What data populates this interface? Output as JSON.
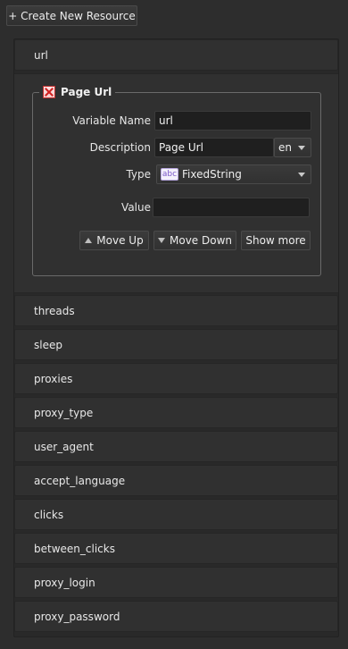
{
  "toolbar": {
    "create_label": "+ Create New Resource"
  },
  "resources": [
    {
      "name": "url"
    },
    {
      "name": "threads"
    },
    {
      "name": "sleep"
    },
    {
      "name": "proxies"
    },
    {
      "name": "proxy_type"
    },
    {
      "name": "user_agent"
    },
    {
      "name": "accept_language"
    },
    {
      "name": "clicks"
    },
    {
      "name": "between_clicks"
    },
    {
      "name": "proxy_login"
    },
    {
      "name": "proxy_password"
    }
  ],
  "editor": {
    "title": "Page Url",
    "close_icon": "red-x-icon",
    "variable_name_label": "Variable Name",
    "variable_name_value": "url",
    "description_label": "Description",
    "description_value": "Page Url",
    "language_value": "en",
    "type_label": "Type",
    "type_icon_text": "abc",
    "type_value": "FixedString",
    "value_label": "Value",
    "value_value": "",
    "move_up_label": "Move Up",
    "move_down_label": "Move Down",
    "show_more_label": "Show more"
  }
}
